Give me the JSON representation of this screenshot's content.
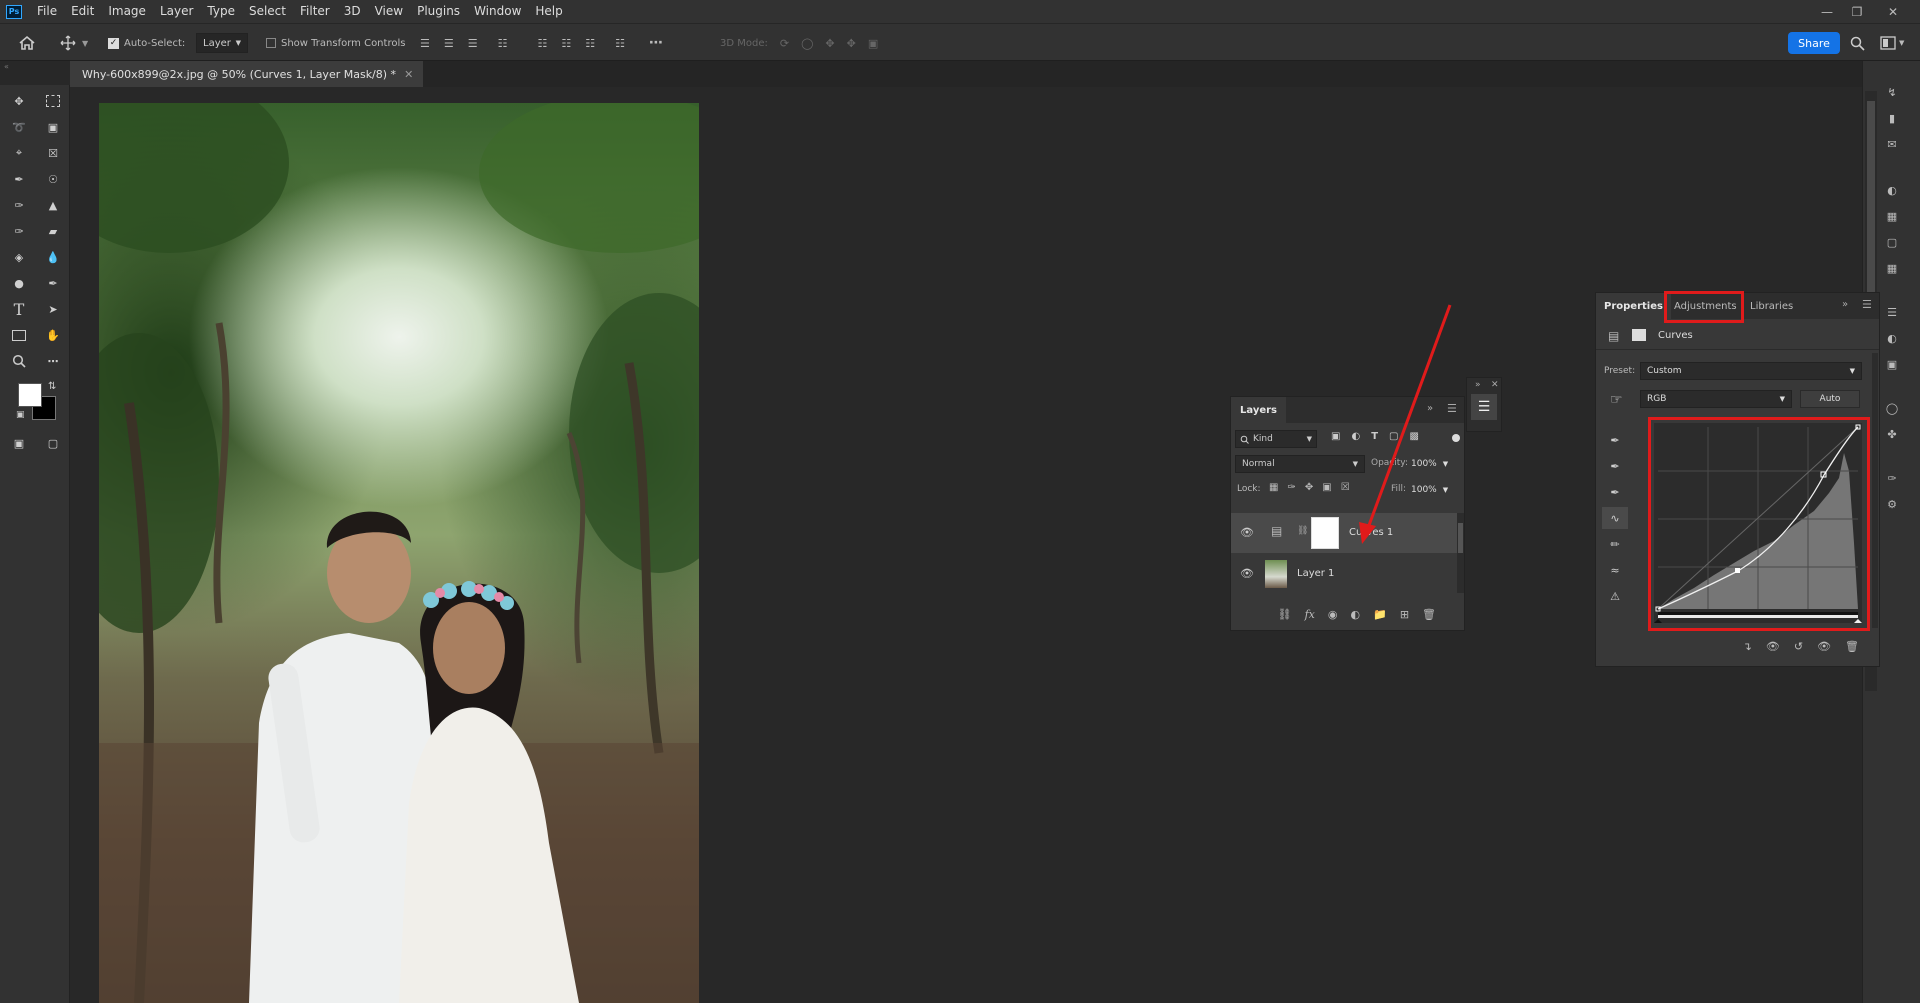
{
  "app": {
    "logo": "Ps"
  },
  "menu": [
    "File",
    "Edit",
    "Image",
    "Layer",
    "Type",
    "Select",
    "Filter",
    "3D",
    "View",
    "Plugins",
    "Window",
    "Help"
  ],
  "options": {
    "auto_select_label": "Auto-Select:",
    "auto_select_value": "Layer",
    "transform_label": "Show Transform Controls",
    "mode_3d": "3D Mode:",
    "share": "Share"
  },
  "document": {
    "tab_title": "Why-600x899@2x.jpg @ 50% (Curves 1, Layer Mask/8) *"
  },
  "layers_panel": {
    "tab": "Layers",
    "filter_kind": "Kind",
    "blend_mode": "Normal",
    "opacity_label": "Opacity:",
    "opacity": "100%",
    "lock_label": "Lock:",
    "fill_label": "Fill:",
    "fill": "100%",
    "layers": [
      {
        "name": "Curves 1",
        "type": "adjustment",
        "selected": true
      },
      {
        "name": "Layer 1",
        "type": "pixel",
        "selected": false
      }
    ]
  },
  "properties_panel": {
    "tabs": [
      "Properties",
      "Adjustments",
      "Libraries"
    ],
    "active_tab": "Properties",
    "highlighted_tab": "Adjustments",
    "adjustment_name": "Curves",
    "preset_label": "Preset:",
    "preset": "Custom",
    "channel": "RGB",
    "auto": "Auto"
  },
  "colors": {
    "accent": "#1473e6",
    "highlight": "#e01b1b",
    "panel": "#383838",
    "panel_header": "#2d2d2d"
  }
}
